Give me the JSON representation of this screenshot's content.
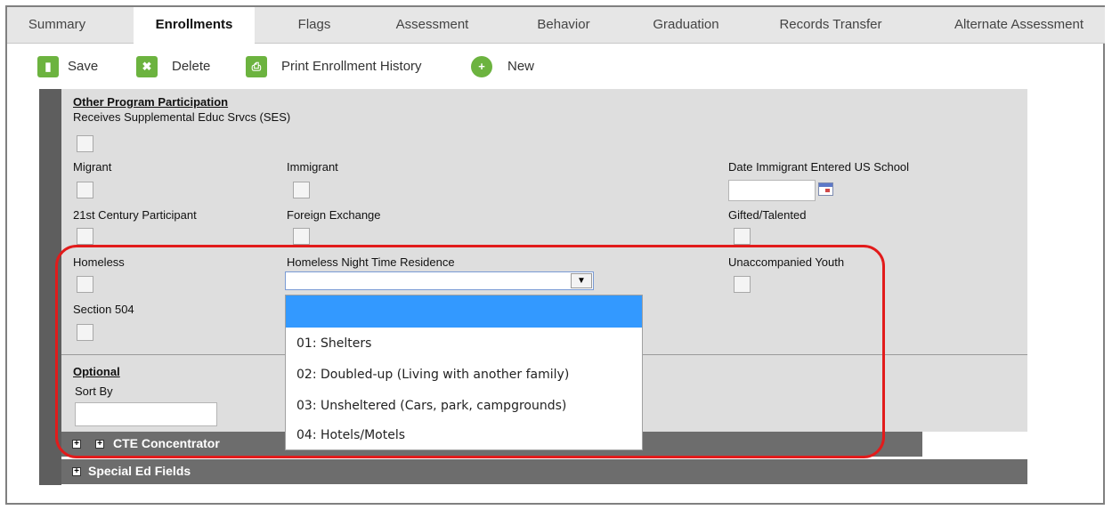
{
  "tabs": [
    {
      "label": "Summary"
    },
    {
      "label": "Enrollments"
    },
    {
      "label": "Flags"
    },
    {
      "label": "Assessment"
    },
    {
      "label": "Behavior"
    },
    {
      "label": "Graduation"
    },
    {
      "label": "Records Transfer"
    },
    {
      "label": "Alternate Assessment"
    }
  ],
  "active_tab": "Enrollments",
  "toolbar": {
    "save_label": "Save",
    "delete_label": "Delete",
    "print_label": "Print Enrollment History",
    "new_label": "New"
  },
  "section": {
    "title": "Other Program Participation",
    "ses_label": "Receives Supplemental Educ Srvcs (SES)",
    "migrant_label": "Migrant",
    "immigrant_label": "Immigrant",
    "date_immigrant_label": "Date Immigrant Entered US School",
    "date_immigrant_value": "",
    "century21_label": "21st Century Participant",
    "foreign_exchange_label": "Foreign Exchange",
    "gifted_label": "Gifted/Talented",
    "homeless_label": "Homeless",
    "homeless_residence_label": "Homeless Night Time Residence",
    "homeless_residence_value": "",
    "unaccompanied_label": "Unaccompanied Youth",
    "section504_label": "Section 504"
  },
  "dropdown": {
    "options": [
      "",
      "01: Shelters",
      "02: Doubled-up (Living with another family)",
      "03: Unsheltered (Cars, park, campgrounds)",
      "04: Hotels/Motels"
    ]
  },
  "optional": {
    "title": "Optional",
    "sort_by_label": "Sort By",
    "sort_by_value": ""
  },
  "collapsibles": {
    "cte_label": "CTE Concentrator",
    "special_ed_label": "Special Ed Fields"
  },
  "colors": {
    "accent_green": "#6cb33f",
    "highlight_red": "#e21b1b",
    "selected_option": "#3399ff"
  }
}
